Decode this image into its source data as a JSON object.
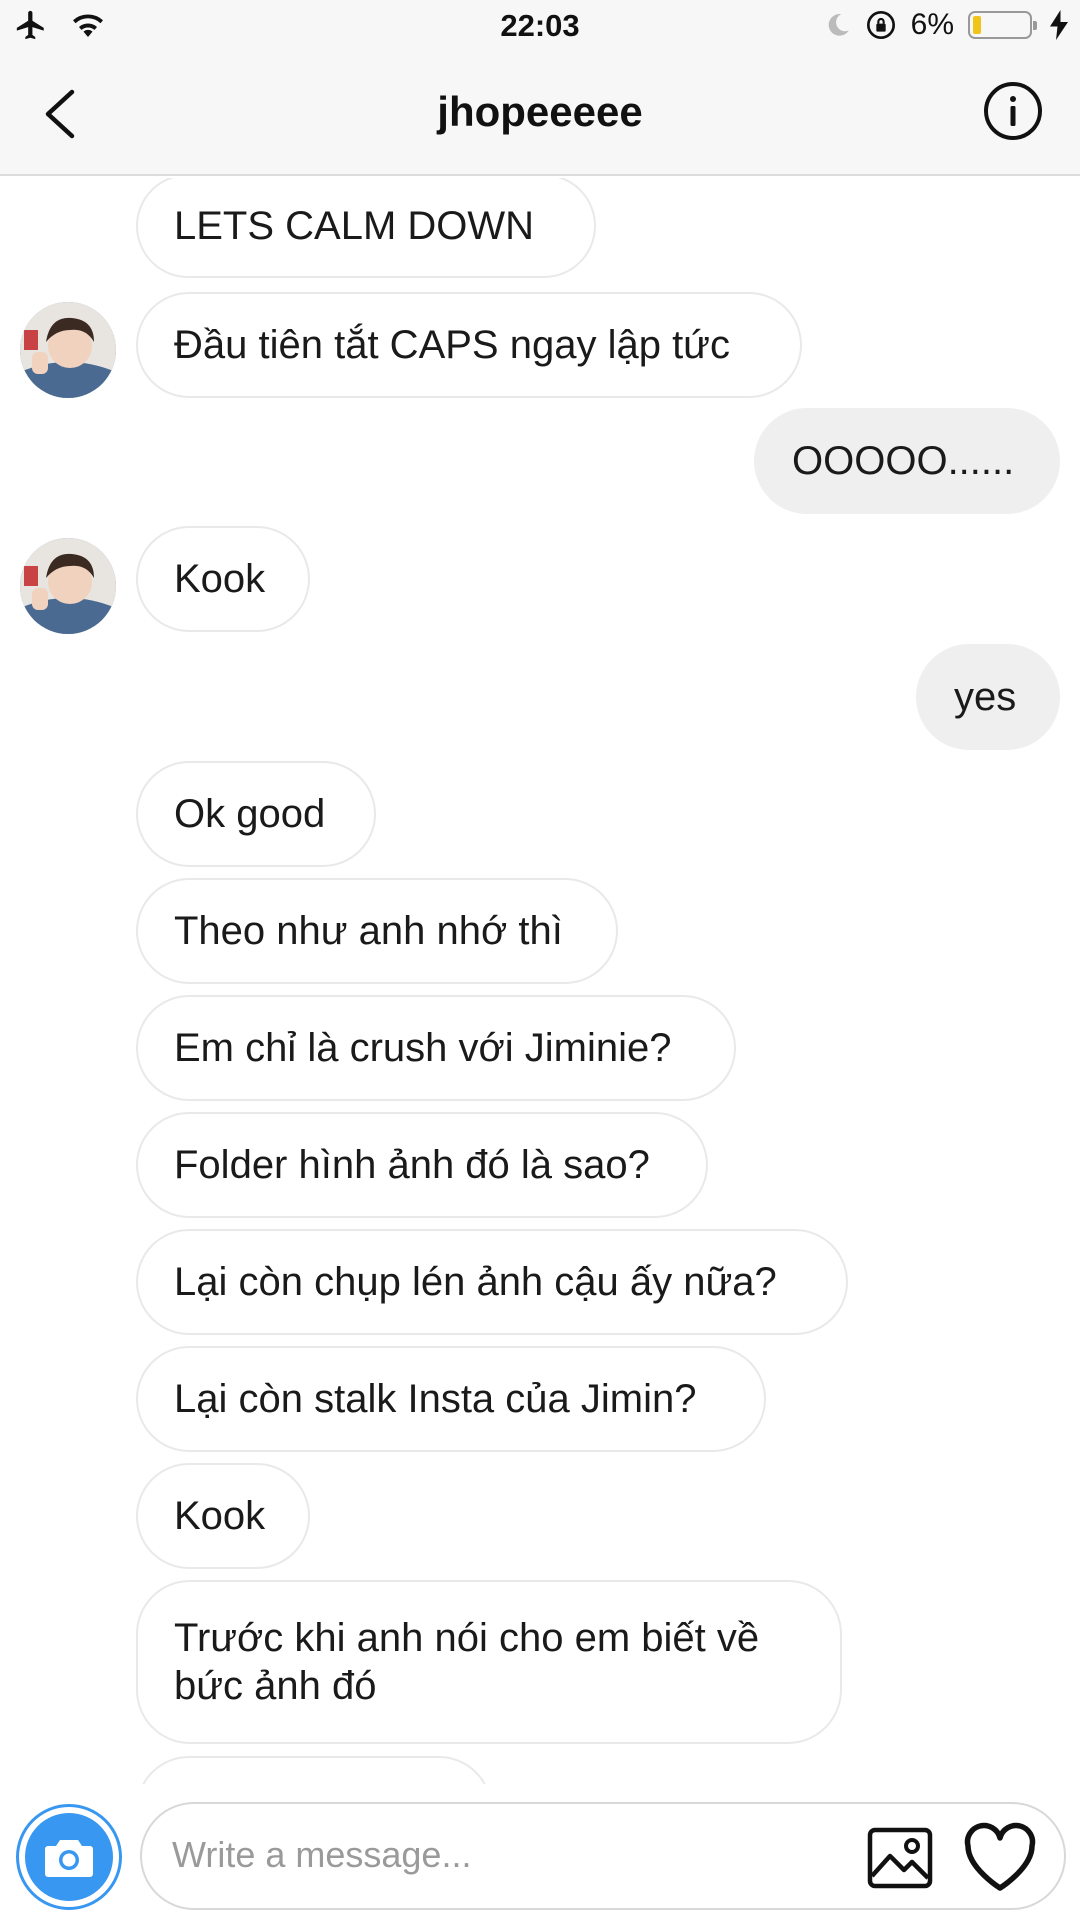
{
  "status_bar": {
    "time": "22:03",
    "battery_percent": "6%",
    "battery_level": 0.06,
    "icons": [
      "airplane-icon",
      "wifi-icon",
      "moon-icon",
      "rotation-lock-icon",
      "battery-icon",
      "charging-bolt-icon"
    ]
  },
  "header": {
    "title": "jhopeeeee",
    "back_icon": "chevron-left-icon",
    "info_icon": "info-icon"
  },
  "messages": [
    {
      "text": "LETS CALM DOWN",
      "direction": "received"
    },
    {
      "text": "Đầu tiên tắt CAPS ngay lập tức",
      "direction": "received"
    },
    {
      "text": "OOOOO......",
      "direction": "sent"
    },
    {
      "text": "Kook",
      "direction": "received"
    },
    {
      "text": "yes",
      "direction": "sent"
    },
    {
      "text": "Ok good",
      "direction": "received"
    },
    {
      "text": "Theo như anh nhớ thì",
      "direction": "received"
    },
    {
      "text": "Em chỉ là crush với Jiminie?",
      "direction": "received"
    },
    {
      "text": "Folder hình ảnh đó là sao?",
      "direction": "received"
    },
    {
      "text": "Lại còn chụp lén ảnh cậu ấy nữa?",
      "direction": "received"
    },
    {
      "text": "Lại còn stalk Insta của Jimin?",
      "direction": "received"
    },
    {
      "text": "Kook",
      "direction": "received"
    },
    {
      "text": "Trước khi anh nói cho em biết về bức ảnh đó",
      "direction": "received"
    }
  ],
  "composer": {
    "placeholder": "Write a message...",
    "camera_icon": "camera-icon",
    "gallery_icon": "gallery-icon",
    "heart_icon": "heart-icon"
  },
  "colors": {
    "accent": "#3897f0",
    "sent_bubble": "#efefef",
    "bubble_border": "#e9e9e9",
    "battery_fill": "#f0c419"
  }
}
